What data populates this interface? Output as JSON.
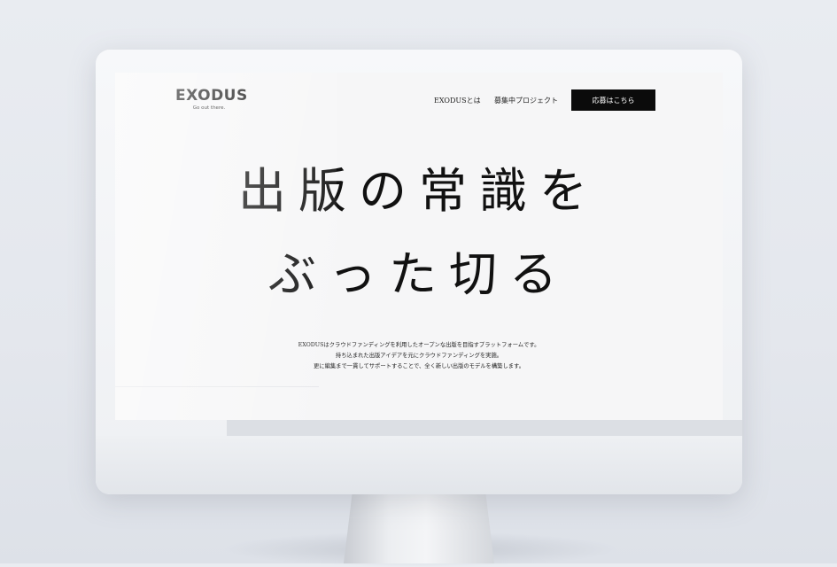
{
  "logo": {
    "wordmark": "EXODUS",
    "tagline": "Go out there."
  },
  "nav": {
    "about": "EXODUSとは",
    "projects": "募集中プロジェクト"
  },
  "cta": {
    "apply_label": "応募はこちら"
  },
  "hero": {
    "line1": "出版の常識を",
    "line2": "ぶった切る"
  },
  "description": {
    "line1": "EXODUSはクラウドファンディングを利用したオープンな出版を目指すプラットフォームです。",
    "line2": "持ち込まれた出版アイデアを元にクラウドファンディングを実施。",
    "line3": "更に編集まで一貫してサポートすることで、全く新しい出版のモデルを構築します。"
  },
  "colors": {
    "accent": "#0b0b0b",
    "screen_background": "#f6f6f7",
    "text": "#111111"
  }
}
